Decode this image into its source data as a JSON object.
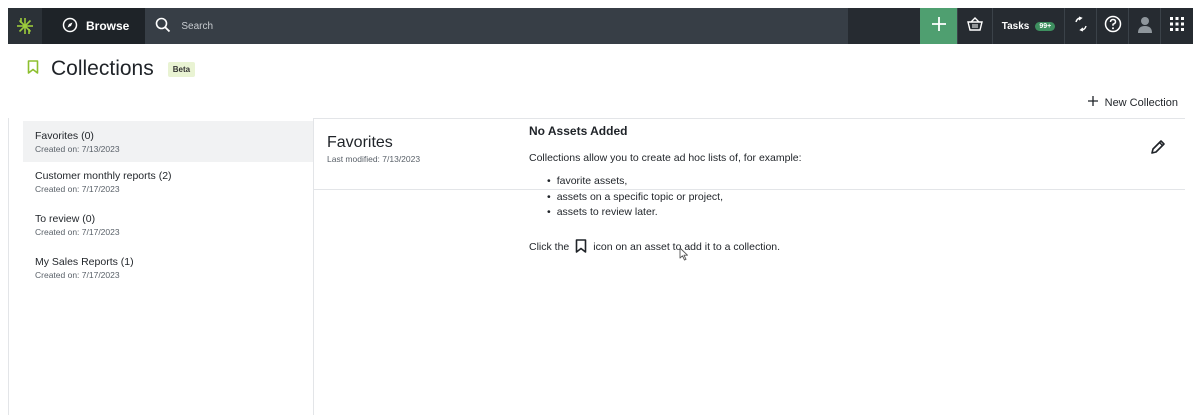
{
  "topbar": {
    "browse_label": "Browse",
    "search_placeholder": "Search",
    "tasks_label": "Tasks",
    "tasks_badge": "99+",
    "accent_color": "#4f9f70",
    "icons": [
      "logo-icon",
      "compass-icon",
      "search-icon",
      "plus-icon",
      "basket-icon",
      "lineage-icon",
      "help-icon",
      "user-icon",
      "apps-grid-icon"
    ]
  },
  "page": {
    "title": "Collections",
    "badge": "Beta",
    "new_collection_label": "New Collection"
  },
  "collections": [
    {
      "name": "Favorites (0)",
      "created": "Created on: 7/13/2023",
      "active": true
    },
    {
      "name": "Customer monthly reports (2)",
      "created": "Created on: 7/17/2023",
      "active": false
    },
    {
      "name": "To review (0)",
      "created": "Created on: 7/17/2023",
      "active": false
    },
    {
      "name": "My Sales Reports (1)",
      "created": "Created on: 7/17/2023",
      "active": false
    }
  ],
  "detail": {
    "title": "Favorites",
    "modified": "Last modified: 7/13/2023",
    "empty": {
      "title": "No Assets Added",
      "text": "Collections allow you to create ad hoc lists of, for example:",
      "items": [
        "favorite assets,",
        "assets on a specific topic or project,",
        "assets to review later."
      ],
      "hint_before": "Click the",
      "hint_after": "icon on an asset to add it to a collection."
    }
  }
}
